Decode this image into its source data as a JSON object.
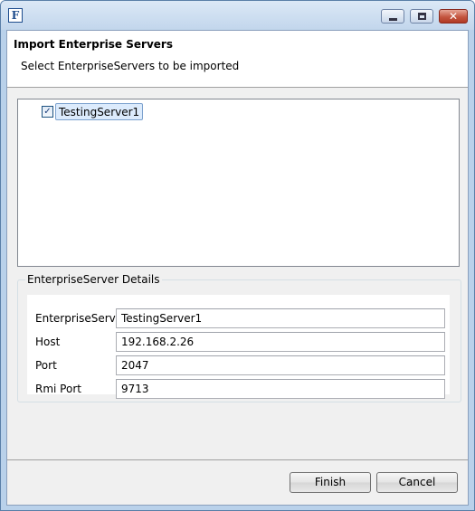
{
  "window": {
    "app_icon_glyph": "F",
    "controls": {
      "minimize": "minimize-icon",
      "maximize": "maximize-icon",
      "close": "close-icon",
      "close_glyph": "✕"
    }
  },
  "header": {
    "title": "Import Enterprise Servers",
    "description": "Select EnterpriseServers to be imported"
  },
  "tree": {
    "items": [
      {
        "label": "TestingServer1",
        "checked": true,
        "check_glyph": "✓"
      }
    ]
  },
  "details": {
    "legend": "EnterpriseServer Details",
    "fields": [
      {
        "label": "EnterpriseServer",
        "value": "TestingServer1"
      },
      {
        "label": "Host",
        "value": "192.168.2.26"
      },
      {
        "label": "Port",
        "value": "2047"
      },
      {
        "label": "Rmi Port",
        "value": "9713"
      }
    ]
  },
  "buttons": {
    "finish": "Finish",
    "cancel": "Cancel"
  },
  "colors": {
    "title_bar": "#c2d6ec",
    "selection": "#dcebfc",
    "close_button": "#c45640"
  }
}
